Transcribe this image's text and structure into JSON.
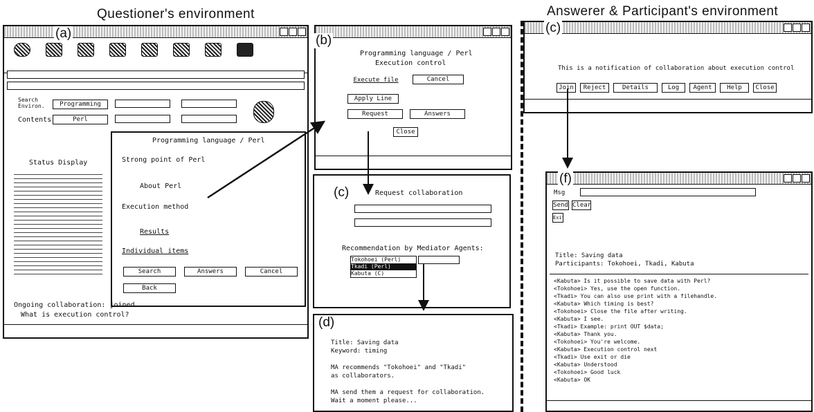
{
  "headings": {
    "questioner": "Questioner's environment",
    "answerer": "Answerer & Participant's environment"
  },
  "panel_a": {
    "badge": "(a)",
    "search_label": "Search Environ.",
    "search_value": "Programming",
    "domain_label": "Contents",
    "domain_value": "Perl",
    "status_display_label": "Status Display",
    "tree_title": "Programming language / Perl",
    "tree_items": [
      "Strong point of Perl",
      "About Perl",
      "Execution method",
      "Results",
      "Individual items"
    ],
    "buttons": [
      "Search",
      "Answers",
      "Cancel"
    ],
    "back_button": "Back",
    "status_lines": [
      "Ongoing collaboration: joined",
      "What is execution control?"
    ]
  },
  "panel_b": {
    "badge": "(b)",
    "title_line1": "Programming language / Perl",
    "title_line2": "Execution control",
    "link_button": "Execute file",
    "cancel_button": "Cancel",
    "apply_button": "Apply Line",
    "request_button": "Request",
    "answers_button": "Answers",
    "close_button": "Close"
  },
  "panel_c_left": {
    "badge": "(c)",
    "title": "Request collaboration",
    "recommend_label": "Recommendation by Mediator Agents:",
    "list_items": [
      "Tokohoei (Perl)",
      "Tkadi (Perl)",
      "Kabuta (C)"
    ]
  },
  "panel_d": {
    "badge": "(d)",
    "lines": [
      "Title: Saving data",
      "Keyword: timing",
      "",
      "MA recommends \"Tokohoei\" and \"Tkadi\"",
      "as collaborators.",
      "",
      "MA send them a request for collaboration.",
      "Wait a moment please..."
    ]
  },
  "panel_c_right": {
    "badge": "(c)",
    "message": "This is a notification of collaboration about execution control",
    "buttons": [
      "Join",
      "Reject",
      "Details",
      "Log",
      "Agent",
      "Help",
      "Close"
    ]
  },
  "panel_f": {
    "badge": "(f)",
    "input_label": "Msg",
    "buttons": [
      "Send",
      "Clear"
    ],
    "exit_button": "Exit",
    "title_line": "Title: Saving data",
    "participants_line": "Participants: Tokohoei, Tkadi, Kabuta",
    "log_lines": [
      "<Kabuta> Is it possible to save data with Perl?",
      "<Tokohoei> Yes, use the open function.",
      "<Tkadi> You can also use print with a filehandle.",
      "<Kabuta> Which timing is best?",
      "<Tokohoei> Close the file after writing.",
      "<Kabuta> I see.",
      "<Tkadi> Example: print OUT $data;",
      "<Kabuta> Thank you.",
      "<Tokohoei> You're welcome.",
      "<Kabuta> Execution control next",
      "<Tkadi> Use exit or die",
      "<Kabuta> Understood",
      "<Tokohoei> Good luck",
      "<Kabuta> OK"
    ]
  }
}
